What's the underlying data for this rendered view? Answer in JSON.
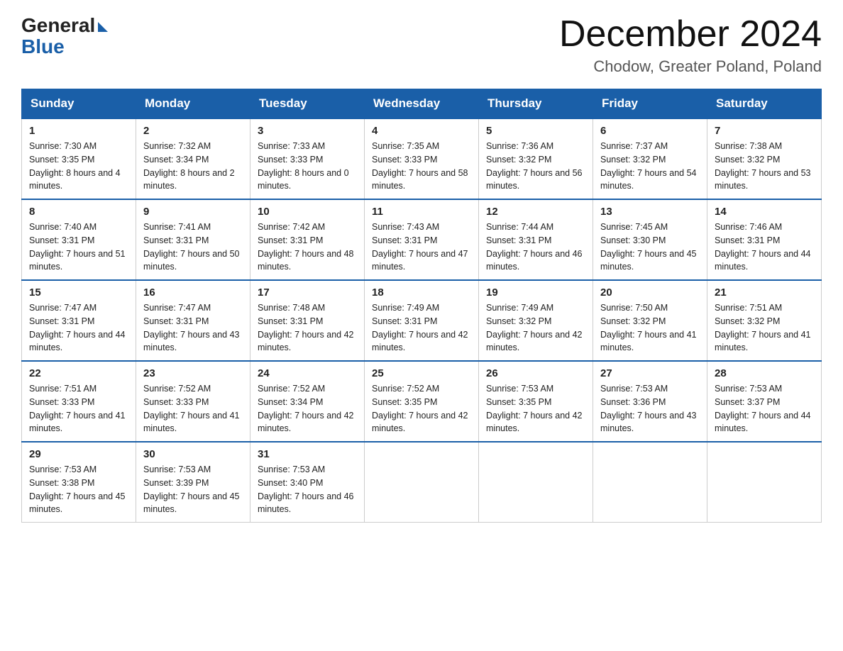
{
  "header": {
    "logo_general": "General",
    "logo_blue": "Blue",
    "title": "December 2024",
    "location": "Chodow, Greater Poland, Poland"
  },
  "days_of_week": [
    "Sunday",
    "Monday",
    "Tuesday",
    "Wednesday",
    "Thursday",
    "Friday",
    "Saturday"
  ],
  "weeks": [
    [
      {
        "day": "1",
        "sunrise": "7:30 AM",
        "sunset": "3:35 PM",
        "daylight": "8 hours and 4 minutes."
      },
      {
        "day": "2",
        "sunrise": "7:32 AM",
        "sunset": "3:34 PM",
        "daylight": "8 hours and 2 minutes."
      },
      {
        "day": "3",
        "sunrise": "7:33 AM",
        "sunset": "3:33 PM",
        "daylight": "8 hours and 0 minutes."
      },
      {
        "day": "4",
        "sunrise": "7:35 AM",
        "sunset": "3:33 PM",
        "daylight": "7 hours and 58 minutes."
      },
      {
        "day": "5",
        "sunrise": "7:36 AM",
        "sunset": "3:32 PM",
        "daylight": "7 hours and 56 minutes."
      },
      {
        "day": "6",
        "sunrise": "7:37 AM",
        "sunset": "3:32 PM",
        "daylight": "7 hours and 54 minutes."
      },
      {
        "day": "7",
        "sunrise": "7:38 AM",
        "sunset": "3:32 PM",
        "daylight": "7 hours and 53 minutes."
      }
    ],
    [
      {
        "day": "8",
        "sunrise": "7:40 AM",
        "sunset": "3:31 PM",
        "daylight": "7 hours and 51 minutes."
      },
      {
        "day": "9",
        "sunrise": "7:41 AM",
        "sunset": "3:31 PM",
        "daylight": "7 hours and 50 minutes."
      },
      {
        "day": "10",
        "sunrise": "7:42 AM",
        "sunset": "3:31 PM",
        "daylight": "7 hours and 48 minutes."
      },
      {
        "day": "11",
        "sunrise": "7:43 AM",
        "sunset": "3:31 PM",
        "daylight": "7 hours and 47 minutes."
      },
      {
        "day": "12",
        "sunrise": "7:44 AM",
        "sunset": "3:31 PM",
        "daylight": "7 hours and 46 minutes."
      },
      {
        "day": "13",
        "sunrise": "7:45 AM",
        "sunset": "3:30 PM",
        "daylight": "7 hours and 45 minutes."
      },
      {
        "day": "14",
        "sunrise": "7:46 AM",
        "sunset": "3:31 PM",
        "daylight": "7 hours and 44 minutes."
      }
    ],
    [
      {
        "day": "15",
        "sunrise": "7:47 AM",
        "sunset": "3:31 PM",
        "daylight": "7 hours and 44 minutes."
      },
      {
        "day": "16",
        "sunrise": "7:47 AM",
        "sunset": "3:31 PM",
        "daylight": "7 hours and 43 minutes."
      },
      {
        "day": "17",
        "sunrise": "7:48 AM",
        "sunset": "3:31 PM",
        "daylight": "7 hours and 42 minutes."
      },
      {
        "day": "18",
        "sunrise": "7:49 AM",
        "sunset": "3:31 PM",
        "daylight": "7 hours and 42 minutes."
      },
      {
        "day": "19",
        "sunrise": "7:49 AM",
        "sunset": "3:32 PM",
        "daylight": "7 hours and 42 minutes."
      },
      {
        "day": "20",
        "sunrise": "7:50 AM",
        "sunset": "3:32 PM",
        "daylight": "7 hours and 41 minutes."
      },
      {
        "day": "21",
        "sunrise": "7:51 AM",
        "sunset": "3:32 PM",
        "daylight": "7 hours and 41 minutes."
      }
    ],
    [
      {
        "day": "22",
        "sunrise": "7:51 AM",
        "sunset": "3:33 PM",
        "daylight": "7 hours and 41 minutes."
      },
      {
        "day": "23",
        "sunrise": "7:52 AM",
        "sunset": "3:33 PM",
        "daylight": "7 hours and 41 minutes."
      },
      {
        "day": "24",
        "sunrise": "7:52 AM",
        "sunset": "3:34 PM",
        "daylight": "7 hours and 42 minutes."
      },
      {
        "day": "25",
        "sunrise": "7:52 AM",
        "sunset": "3:35 PM",
        "daylight": "7 hours and 42 minutes."
      },
      {
        "day": "26",
        "sunrise": "7:53 AM",
        "sunset": "3:35 PM",
        "daylight": "7 hours and 42 minutes."
      },
      {
        "day": "27",
        "sunrise": "7:53 AM",
        "sunset": "3:36 PM",
        "daylight": "7 hours and 43 minutes."
      },
      {
        "day": "28",
        "sunrise": "7:53 AM",
        "sunset": "3:37 PM",
        "daylight": "7 hours and 44 minutes."
      }
    ],
    [
      {
        "day": "29",
        "sunrise": "7:53 AM",
        "sunset": "3:38 PM",
        "daylight": "7 hours and 45 minutes."
      },
      {
        "day": "30",
        "sunrise": "7:53 AM",
        "sunset": "3:39 PM",
        "daylight": "7 hours and 45 minutes."
      },
      {
        "day": "31",
        "sunrise": "7:53 AM",
        "sunset": "3:40 PM",
        "daylight": "7 hours and 46 minutes."
      },
      null,
      null,
      null,
      null
    ]
  ]
}
